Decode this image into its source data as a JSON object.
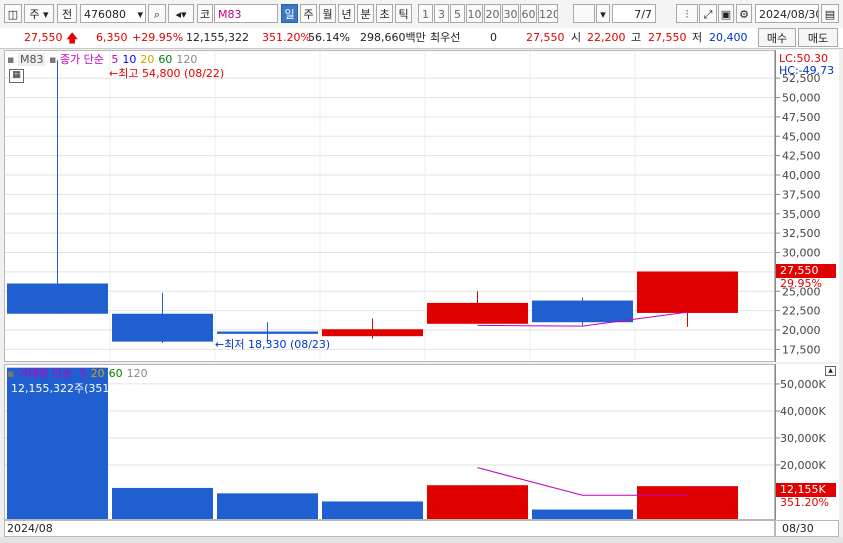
{
  "toolbar": {
    "market_label": "주",
    "prefix_label": "전",
    "code_value": "476080",
    "code_field": "코",
    "code_name": "M83",
    "period_tabs": [
      "일",
      "주",
      "월",
      "년",
      "분",
      "초",
      "틱"
    ],
    "interval_buttons": [
      "1",
      "3",
      "5",
      "10",
      "20",
      "30",
      "60",
      "120"
    ],
    "page_value": "7",
    "page_total": "/7",
    "date_value": "2024/08/30"
  },
  "quote": {
    "price": "27,550",
    "change": "6,350",
    "change_pct": "+29.95%",
    "volume": "12,155,322",
    "volume_pct": "351.20%",
    "turnover_pct": "56.14%",
    "trade_value": "298,660백만",
    "best_label": "최우선",
    "best_value": "0",
    "best_price": "27,550",
    "open_label": "시",
    "open_value": "22,200",
    "high_label": "고",
    "high_value": "27,550",
    "low_label": "저",
    "low_value": "20,400",
    "buy_label": "매수",
    "sell_label": "매도"
  },
  "price_pane": {
    "legend_name": "M83",
    "legend_title": "종가 단순",
    "ma_periods": [
      "5",
      "10",
      "20",
      "60",
      "120"
    ],
    "ma_colors": [
      "#c000c0",
      "#0000ff",
      "#d0a000",
      "#008000",
      "#888888"
    ],
    "high_note": "←최고 54,800 (08/22)",
    "low_note": "←최저 18,330 (08/23)",
    "lc_label": "LC:50.30",
    "hc_label": "HC:-49.73",
    "current_price_tag": "27,550",
    "current_pct_tag": "29.95%"
  },
  "volume_pane": {
    "legend_title": "거래량 단순",
    "ma_periods": [
      "5",
      "20",
      "60",
      "120"
    ],
    "ma_colors": [
      "#c000c0",
      "#d0a000",
      "#008000",
      "#888888"
    ],
    "current_note": "12,155,322주(351.20%)",
    "current_vol_tag": "12,155K",
    "current_pct_tag": "351.20%"
  },
  "footer": {
    "left_date": "2024/08",
    "right_date": "08/30"
  },
  "colors": {
    "up": "#e00000",
    "down": "#1f5fd0",
    "ma5": "#c000c0"
  },
  "chart_data": [
    {
      "type": "candlestick",
      "y_ticks": [
        17500,
        20000,
        22500,
        25000,
        27500,
        30000,
        32500,
        35000,
        37500,
        40000,
        42500,
        45000,
        47500,
        50000,
        52500
      ],
      "y_tick_labels": [
        "17,500",
        "20,000",
        "22,500",
        "25,000",
        "27,500",
        "30,000",
        "32,500",
        "35,000",
        "37,500",
        "40,000",
        "42,500",
        "45,000",
        "47,500",
        "50,000",
        "52,500"
      ],
      "ylim": [
        16000,
        56000
      ],
      "candles": [
        {
          "open": 26000,
          "high": 54800,
          "low": 22100,
          "close": 22100
        },
        {
          "open": 22100,
          "high": 24800,
          "low": 18330,
          "close": 18500
        },
        {
          "open": 19800,
          "high": 21000,
          "low": 18330,
          "close": 19500
        },
        {
          "open": 19200,
          "high": 21500,
          "low": 18900,
          "close": 20100
        },
        {
          "open": 20800,
          "high": 25000,
          "low": 20800,
          "close": 23500
        },
        {
          "open": 23800,
          "high": 24200,
          "low": 20600,
          "close": 21000
        },
        {
          "open": 22200,
          "high": 27550,
          "low": 20400,
          "close": 27550
        }
      ],
      "ma5": [
        null,
        null,
        null,
        null,
        20600,
        20500,
        22300
      ]
    },
    {
      "type": "bar",
      "y_ticks": [
        20000000,
        30000000,
        40000000,
        50000000
      ],
      "y_tick_labels": [
        "20,000K",
        "30,000K",
        "40,000K",
        "50,000K"
      ],
      "ylim": [
        0,
        57000000
      ],
      "values": [
        56000000,
        11500000,
        9500000,
        6500000,
        12500000,
        3500000,
        12155322
      ],
      "directions": [
        "down",
        "down",
        "down",
        "down",
        "up",
        "down",
        "up"
      ],
      "ma5": [
        null,
        null,
        null,
        null,
        19000000,
        8800000,
        8800000
      ]
    }
  ]
}
